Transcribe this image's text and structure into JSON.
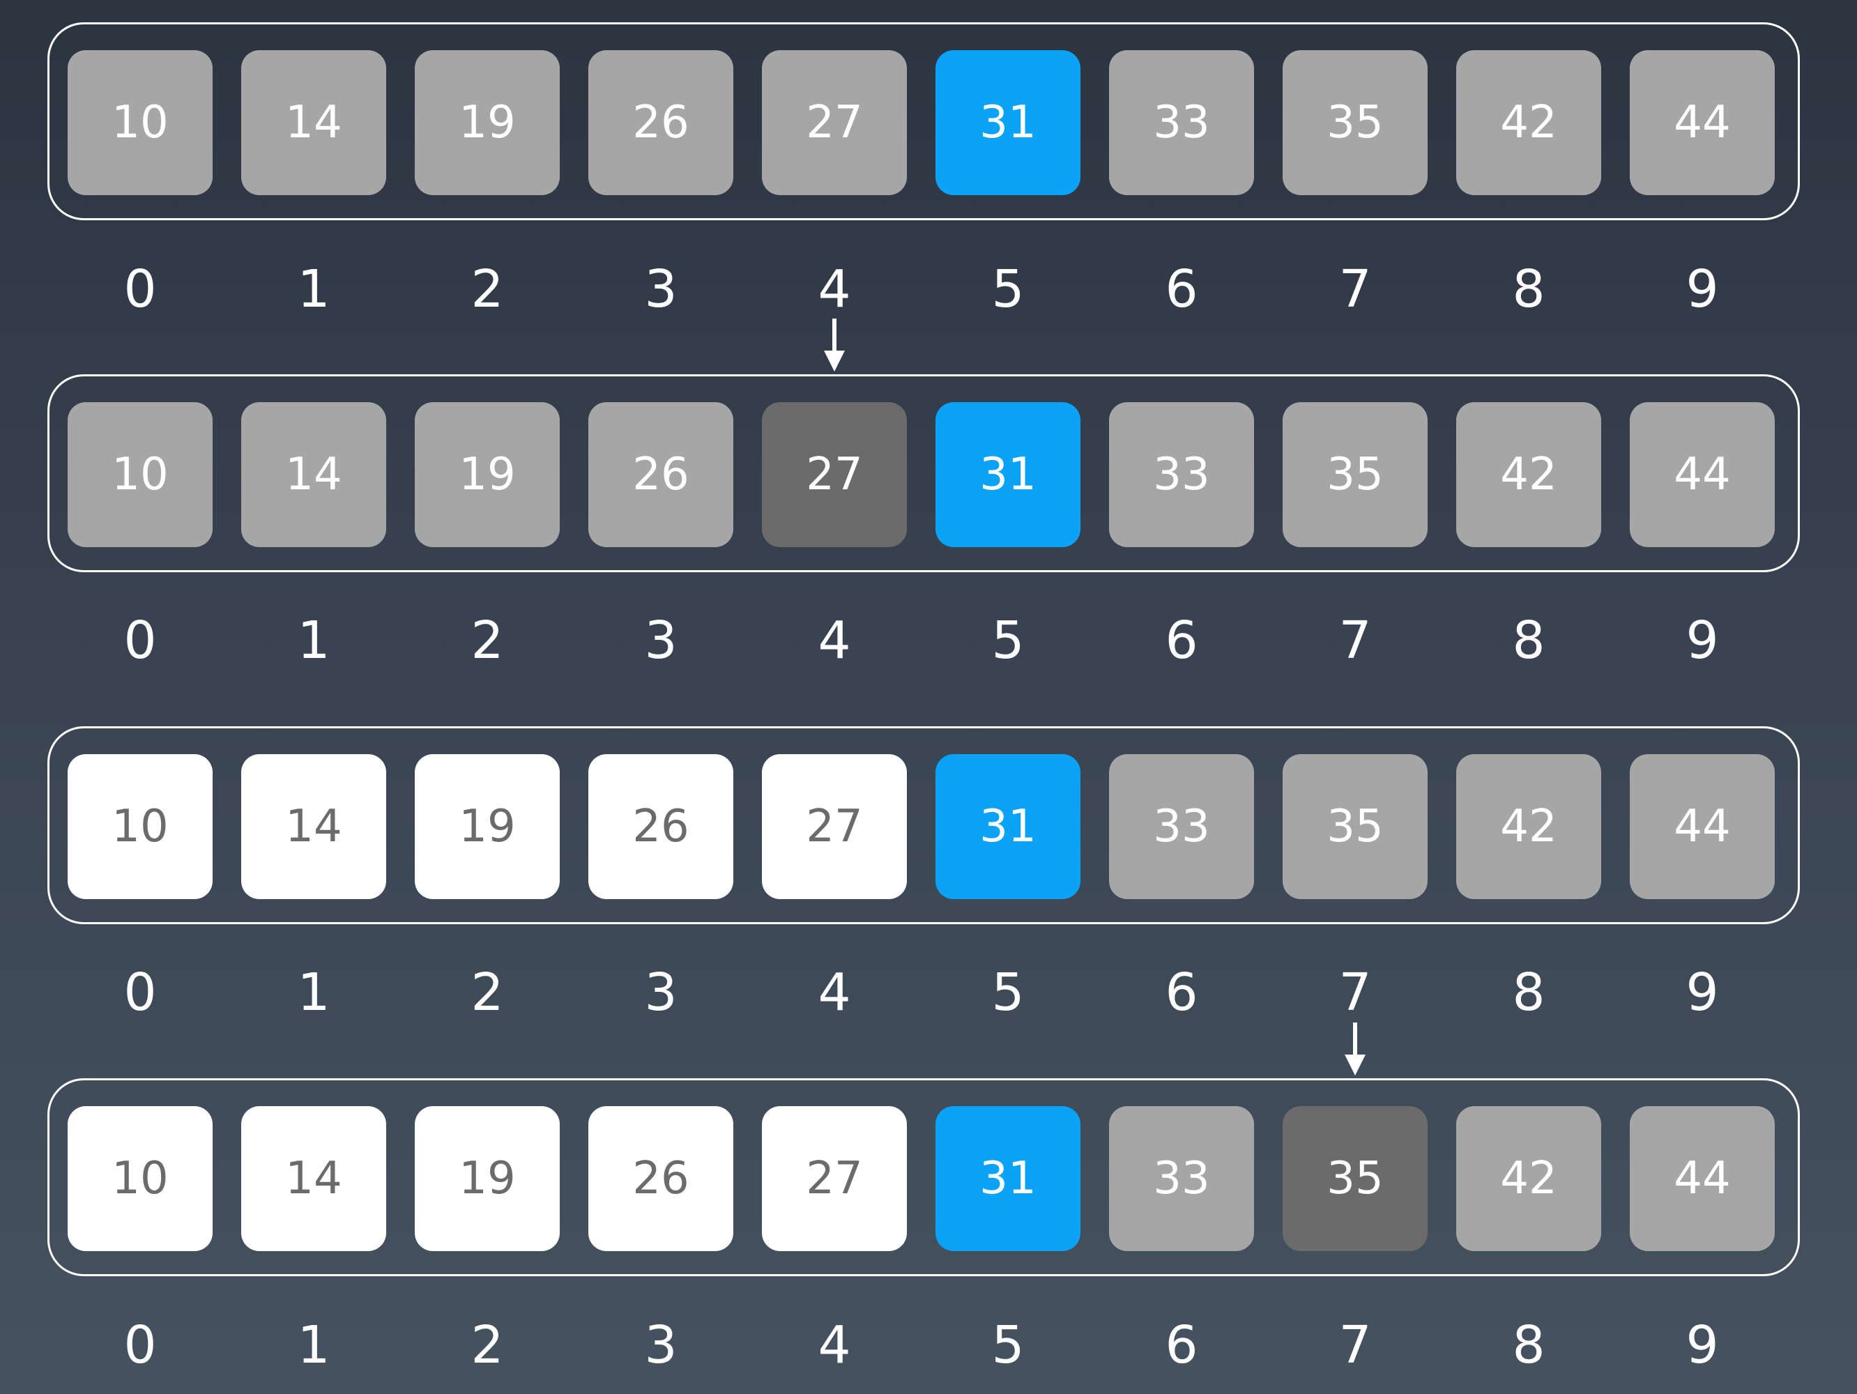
{
  "values": [
    "10",
    "14",
    "19",
    "26",
    "27",
    "31",
    "33",
    "35",
    "42",
    "44"
  ],
  "indices": [
    "0",
    "1",
    "2",
    "3",
    "4",
    "5",
    "6",
    "7",
    "8",
    "9"
  ],
  "rows": [
    {
      "states": [
        "gray",
        "gray",
        "gray",
        "gray",
        "gray",
        "blue",
        "gray",
        "gray",
        "gray",
        "gray"
      ]
    },
    {
      "states": [
        "gray",
        "gray",
        "gray",
        "gray",
        "dark",
        "blue",
        "gray",
        "gray",
        "gray",
        "gray"
      ],
      "pointer_index": 4
    },
    {
      "states": [
        "white",
        "white",
        "white",
        "white",
        "white",
        "blue",
        "gray",
        "gray",
        "gray",
        "gray"
      ]
    },
    {
      "states": [
        "white",
        "white",
        "white",
        "white",
        "white",
        "blue",
        "gray",
        "dark",
        "gray",
        "gray"
      ],
      "pointer_index": 7
    }
  ],
  "colors": {
    "gray": "#a6a6a6",
    "dark": "#6b6b6b",
    "white": "#ffffff",
    "blue": "#0ba3f5"
  }
}
